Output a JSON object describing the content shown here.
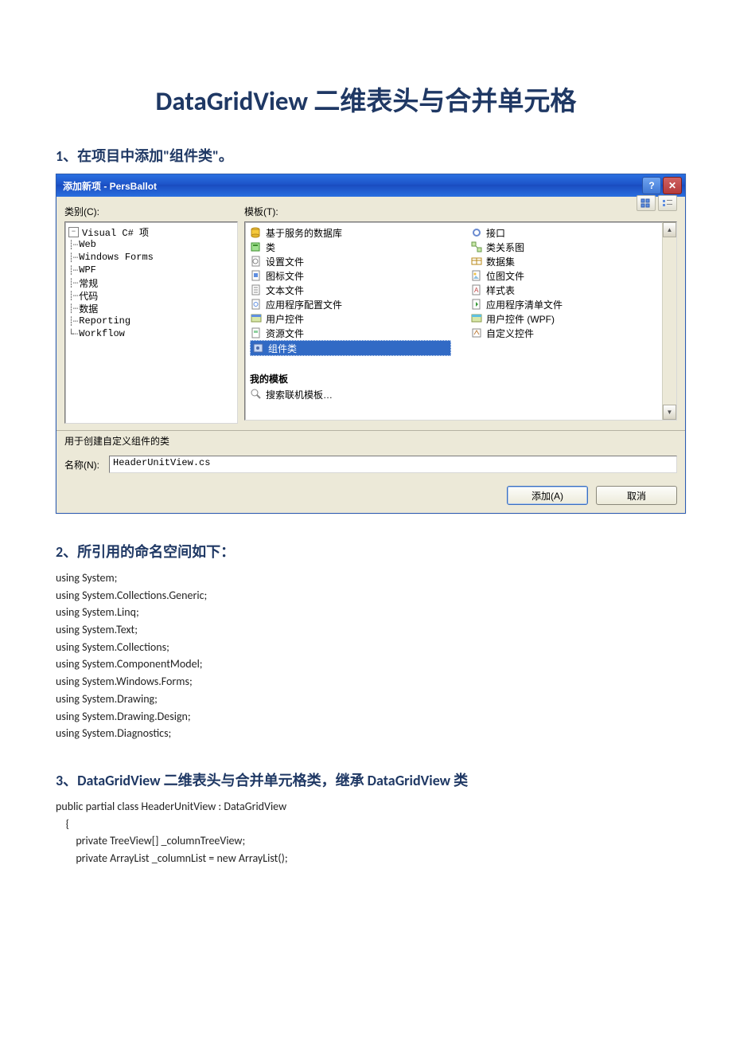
{
  "title": "DataGridView 二维表头与合并单元格",
  "h1": "1、在项目中添加\"组件类\"。",
  "h2": "2、所引用的命名空间如下：",
  "h3": "3、DataGridView 二维表头与合并单元格类，继承 DataGridView 类",
  "usings": [
    "using System;",
    "using System.Collections.Generic;",
    "using System.Linq;",
    "using System.Text;",
    "using System.Collections;",
    "using System.ComponentModel;",
    "using System.Windows.Forms;",
    "using System.Drawing;",
    "using System.Drawing.Design;",
    "using System.Diagnostics;"
  ],
  "class_lines": [
    "public partial class HeaderUnitView : DataGridView",
    "    {",
    "        private TreeView[] _columnTreeView;",
    "        private ArrayList _columnList = new ArrayList();"
  ],
  "dialog": {
    "title": "添加新项 - PersBallot",
    "categories_label": "类别(C):",
    "templates_label": "模板(T):",
    "tree": {
      "root": "Visual C# 项",
      "children": [
        "Web",
        "Windows Forms",
        "WPF",
        "常规",
        "代码",
        "数据",
        "Reporting",
        "Workflow"
      ]
    },
    "templates_left": [
      "基于服务的数据库",
      "类",
      "设置文件",
      "图标文件",
      "文本文件",
      "应用程序配置文件",
      "用户控件",
      "资源文件",
      "组件类"
    ],
    "templates_right": [
      "接口",
      "类关系图",
      "数据集",
      "位图文件",
      "样式表",
      "应用程序清单文件",
      "用户控件 (WPF)",
      "自定义控件"
    ],
    "my_templates_header": "我的模板",
    "search_templates": "搜索联机模板…",
    "description": "用于创建自定义组件的类",
    "name_label": "名称(N):",
    "name_value": "HeaderUnitView.cs",
    "add_button": "添加(A)",
    "cancel_button": "取消"
  }
}
